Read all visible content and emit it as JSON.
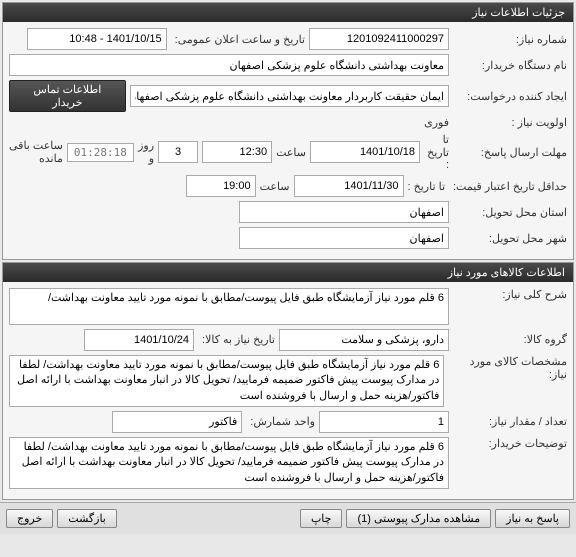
{
  "panel1": {
    "title": "جزئیات اطلاعات نیاز"
  },
  "req": {
    "number_label": "شماره نیاز:",
    "number": "1201092411000297",
    "announce_label": "تاریخ و ساعت اعلان عمومی:",
    "announce": "1401/10/15 - 10:48",
    "buyer_label": "نام دستگاه خریدار:",
    "buyer": "معاونت بهداشتی دانشگاه علوم پزشکی اصفهان",
    "creator_label": "ایجاد کننده درخواست:",
    "creator": "ایمان حقیقت کاربردار معاونت بهداشتی دانشگاه علوم پزشکی اصفهان",
    "contact_btn": "اطلاعات تماس خریدار",
    "priority_label": "اولویت نیاز :",
    "priority": "فوری",
    "deadline_label": "مهلت ارسال پاسخ:",
    "deadline_to_label": "تا تاریخ :",
    "deadline_date": "1401/10/18",
    "time_label": "ساعت",
    "deadline_time": "12:30",
    "days_val": "3",
    "days_label": "روز و",
    "timer": "01:28:18",
    "remain_label": "ساعت باقی مانده",
    "validity_label": "حداقل تاریخ اعتبار قیمت:",
    "validity_to_label": "تا تاریخ :",
    "validity_date": "1401/11/30",
    "validity_time": "19:00",
    "province_label": "استان محل تحویل:",
    "province": "اصفهان",
    "city_label": "شهر محل تحویل:",
    "city": "اصفهان"
  },
  "panel2": {
    "title": "اطلاعات کالاهای مورد نیاز"
  },
  "item": {
    "desc_label": "شرح کلی نیاز:",
    "desc": "6 قلم مورد نیاز آزمایشگاه طبق فایل پیوست/مطابق با نمونه مورد تایید معاونت بهداشت/",
    "group_label": "گروه کالا:",
    "group": "دارو، پزشکی و سلامت",
    "need_date_label": "تاریخ نیاز به کالا:",
    "need_date": "1401/10/24",
    "spec_label": "مشخصات کالای مورد نیاز:",
    "spec": "6 قلم مورد نیاز آزمایشگاه طبق فایل پیوست/مطابق با نمونه مورد تایید معاونت بهداشت/ لطفا در مدارک پیوست پیش فاکتور ضمیمه فرمایید/ تحویل کالا در انبار معاونت بهداشت با ارائه اصل فاکتور/هزینه حمل و ارسال با فروشنده است",
    "qty_label": "تعداد / مقدار نیاز:",
    "qty": "1",
    "unit_label": "واحد شمارش:",
    "unit": "فاکتور",
    "buyer_notes_label": "توضیحات خریدار:",
    "buyer_notes": "6 قلم مورد نیاز آزمایشگاه طبق فایل پیوست/مطابق با نمونه مورد تایید معاونت بهداشت/ لطفا در مدارک پیوست پیش فاکتور ضمیمه فرمایید/ تحویل کالا در انبار معاونت بهداشت با ارائه اصل فاکتور/هزینه حمل و ارسال با فروشنده است"
  },
  "footer": {
    "reply": "پاسخ به نیاز",
    "attachments": "مشاهده مدارک پیوستی (1)",
    "print": "چاپ",
    "back": "بازگشت",
    "exit": "خروج"
  }
}
